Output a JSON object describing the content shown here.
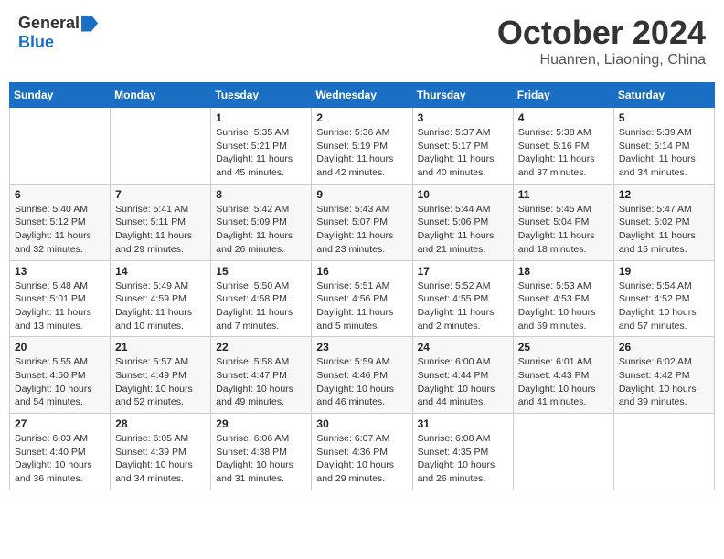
{
  "header": {
    "logo_general": "General",
    "logo_blue": "Blue",
    "title": "October 2024",
    "location": "Huanren, Liaoning, China"
  },
  "days_of_week": [
    "Sunday",
    "Monday",
    "Tuesday",
    "Wednesday",
    "Thursday",
    "Friday",
    "Saturday"
  ],
  "weeks": [
    [
      {
        "day": "",
        "sunrise": "",
        "sunset": "",
        "daylight": ""
      },
      {
        "day": "",
        "sunrise": "",
        "sunset": "",
        "daylight": ""
      },
      {
        "day": "1",
        "sunrise": "Sunrise: 5:35 AM",
        "sunset": "Sunset: 5:21 PM",
        "daylight": "Daylight: 11 hours and 45 minutes."
      },
      {
        "day": "2",
        "sunrise": "Sunrise: 5:36 AM",
        "sunset": "Sunset: 5:19 PM",
        "daylight": "Daylight: 11 hours and 42 minutes."
      },
      {
        "day": "3",
        "sunrise": "Sunrise: 5:37 AM",
        "sunset": "Sunset: 5:17 PM",
        "daylight": "Daylight: 11 hours and 40 minutes."
      },
      {
        "day": "4",
        "sunrise": "Sunrise: 5:38 AM",
        "sunset": "Sunset: 5:16 PM",
        "daylight": "Daylight: 11 hours and 37 minutes."
      },
      {
        "day": "5",
        "sunrise": "Sunrise: 5:39 AM",
        "sunset": "Sunset: 5:14 PM",
        "daylight": "Daylight: 11 hours and 34 minutes."
      }
    ],
    [
      {
        "day": "6",
        "sunrise": "Sunrise: 5:40 AM",
        "sunset": "Sunset: 5:12 PM",
        "daylight": "Daylight: 11 hours and 32 minutes."
      },
      {
        "day": "7",
        "sunrise": "Sunrise: 5:41 AM",
        "sunset": "Sunset: 5:11 PM",
        "daylight": "Daylight: 11 hours and 29 minutes."
      },
      {
        "day": "8",
        "sunrise": "Sunrise: 5:42 AM",
        "sunset": "Sunset: 5:09 PM",
        "daylight": "Daylight: 11 hours and 26 minutes."
      },
      {
        "day": "9",
        "sunrise": "Sunrise: 5:43 AM",
        "sunset": "Sunset: 5:07 PM",
        "daylight": "Daylight: 11 hours and 23 minutes."
      },
      {
        "day": "10",
        "sunrise": "Sunrise: 5:44 AM",
        "sunset": "Sunset: 5:06 PM",
        "daylight": "Daylight: 11 hours and 21 minutes."
      },
      {
        "day": "11",
        "sunrise": "Sunrise: 5:45 AM",
        "sunset": "Sunset: 5:04 PM",
        "daylight": "Daylight: 11 hours and 18 minutes."
      },
      {
        "day": "12",
        "sunrise": "Sunrise: 5:47 AM",
        "sunset": "Sunset: 5:02 PM",
        "daylight": "Daylight: 11 hours and 15 minutes."
      }
    ],
    [
      {
        "day": "13",
        "sunrise": "Sunrise: 5:48 AM",
        "sunset": "Sunset: 5:01 PM",
        "daylight": "Daylight: 11 hours and 13 minutes."
      },
      {
        "day": "14",
        "sunrise": "Sunrise: 5:49 AM",
        "sunset": "Sunset: 4:59 PM",
        "daylight": "Daylight: 11 hours and 10 minutes."
      },
      {
        "day": "15",
        "sunrise": "Sunrise: 5:50 AM",
        "sunset": "Sunset: 4:58 PM",
        "daylight": "Daylight: 11 hours and 7 minutes."
      },
      {
        "day": "16",
        "sunrise": "Sunrise: 5:51 AM",
        "sunset": "Sunset: 4:56 PM",
        "daylight": "Daylight: 11 hours and 5 minutes."
      },
      {
        "day": "17",
        "sunrise": "Sunrise: 5:52 AM",
        "sunset": "Sunset: 4:55 PM",
        "daylight": "Daylight: 11 hours and 2 minutes."
      },
      {
        "day": "18",
        "sunrise": "Sunrise: 5:53 AM",
        "sunset": "Sunset: 4:53 PM",
        "daylight": "Daylight: 10 hours and 59 minutes."
      },
      {
        "day": "19",
        "sunrise": "Sunrise: 5:54 AM",
        "sunset": "Sunset: 4:52 PM",
        "daylight": "Daylight: 10 hours and 57 minutes."
      }
    ],
    [
      {
        "day": "20",
        "sunrise": "Sunrise: 5:55 AM",
        "sunset": "Sunset: 4:50 PM",
        "daylight": "Daylight: 10 hours and 54 minutes."
      },
      {
        "day": "21",
        "sunrise": "Sunrise: 5:57 AM",
        "sunset": "Sunset: 4:49 PM",
        "daylight": "Daylight: 10 hours and 52 minutes."
      },
      {
        "day": "22",
        "sunrise": "Sunrise: 5:58 AM",
        "sunset": "Sunset: 4:47 PM",
        "daylight": "Daylight: 10 hours and 49 minutes."
      },
      {
        "day": "23",
        "sunrise": "Sunrise: 5:59 AM",
        "sunset": "Sunset: 4:46 PM",
        "daylight": "Daylight: 10 hours and 46 minutes."
      },
      {
        "day": "24",
        "sunrise": "Sunrise: 6:00 AM",
        "sunset": "Sunset: 4:44 PM",
        "daylight": "Daylight: 10 hours and 44 minutes."
      },
      {
        "day": "25",
        "sunrise": "Sunrise: 6:01 AM",
        "sunset": "Sunset: 4:43 PM",
        "daylight": "Daylight: 10 hours and 41 minutes."
      },
      {
        "day": "26",
        "sunrise": "Sunrise: 6:02 AM",
        "sunset": "Sunset: 4:42 PM",
        "daylight": "Daylight: 10 hours and 39 minutes."
      }
    ],
    [
      {
        "day": "27",
        "sunrise": "Sunrise: 6:03 AM",
        "sunset": "Sunset: 4:40 PM",
        "daylight": "Daylight: 10 hours and 36 minutes."
      },
      {
        "day": "28",
        "sunrise": "Sunrise: 6:05 AM",
        "sunset": "Sunset: 4:39 PM",
        "daylight": "Daylight: 10 hours and 34 minutes."
      },
      {
        "day": "29",
        "sunrise": "Sunrise: 6:06 AM",
        "sunset": "Sunset: 4:38 PM",
        "daylight": "Daylight: 10 hours and 31 minutes."
      },
      {
        "day": "30",
        "sunrise": "Sunrise: 6:07 AM",
        "sunset": "Sunset: 4:36 PM",
        "daylight": "Daylight: 10 hours and 29 minutes."
      },
      {
        "day": "31",
        "sunrise": "Sunrise: 6:08 AM",
        "sunset": "Sunset: 4:35 PM",
        "daylight": "Daylight: 10 hours and 26 minutes."
      },
      {
        "day": "",
        "sunrise": "",
        "sunset": "",
        "daylight": ""
      },
      {
        "day": "",
        "sunrise": "",
        "sunset": "",
        "daylight": ""
      }
    ]
  ]
}
